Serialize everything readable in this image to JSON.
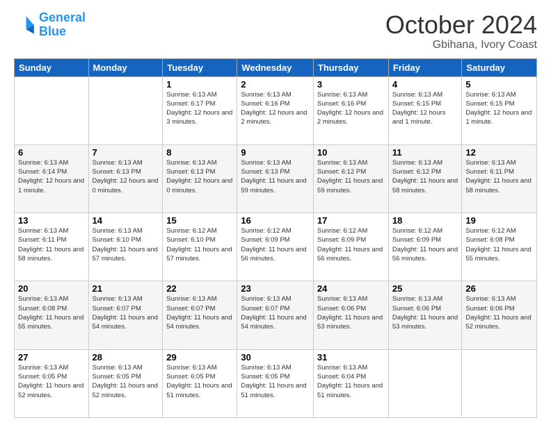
{
  "header": {
    "logo_line1": "General",
    "logo_line2": "Blue",
    "title": "October 2024",
    "subtitle": "Gbihana, Ivory Coast"
  },
  "days_of_week": [
    "Sunday",
    "Monday",
    "Tuesday",
    "Wednesday",
    "Thursday",
    "Friday",
    "Saturday"
  ],
  "weeks": [
    [
      {
        "day": "",
        "info": ""
      },
      {
        "day": "",
        "info": ""
      },
      {
        "day": "1",
        "info": "Sunrise: 6:13 AM\nSunset: 6:17 PM\nDaylight: 12 hours and 3 minutes."
      },
      {
        "day": "2",
        "info": "Sunrise: 6:13 AM\nSunset: 6:16 PM\nDaylight: 12 hours and 2 minutes."
      },
      {
        "day": "3",
        "info": "Sunrise: 6:13 AM\nSunset: 6:16 PM\nDaylight: 12 hours and 2 minutes."
      },
      {
        "day": "4",
        "info": "Sunrise: 6:13 AM\nSunset: 6:15 PM\nDaylight: 12 hours and 1 minute."
      },
      {
        "day": "5",
        "info": "Sunrise: 6:13 AM\nSunset: 6:15 PM\nDaylight: 12 hours and 1 minute."
      }
    ],
    [
      {
        "day": "6",
        "info": "Sunrise: 6:13 AM\nSunset: 6:14 PM\nDaylight: 12 hours and 1 minute."
      },
      {
        "day": "7",
        "info": "Sunrise: 6:13 AM\nSunset: 6:13 PM\nDaylight: 12 hours and 0 minutes."
      },
      {
        "day": "8",
        "info": "Sunrise: 6:13 AM\nSunset: 6:13 PM\nDaylight: 12 hours and 0 minutes."
      },
      {
        "day": "9",
        "info": "Sunrise: 6:13 AM\nSunset: 6:13 PM\nDaylight: 11 hours and 59 minutes."
      },
      {
        "day": "10",
        "info": "Sunrise: 6:13 AM\nSunset: 6:12 PM\nDaylight: 11 hours and 59 minutes."
      },
      {
        "day": "11",
        "info": "Sunrise: 6:13 AM\nSunset: 6:12 PM\nDaylight: 11 hours and 58 minutes."
      },
      {
        "day": "12",
        "info": "Sunrise: 6:13 AM\nSunset: 6:11 PM\nDaylight: 11 hours and 58 minutes."
      }
    ],
    [
      {
        "day": "13",
        "info": "Sunrise: 6:13 AM\nSunset: 6:11 PM\nDaylight: 11 hours and 58 minutes."
      },
      {
        "day": "14",
        "info": "Sunrise: 6:13 AM\nSunset: 6:10 PM\nDaylight: 11 hours and 57 minutes."
      },
      {
        "day": "15",
        "info": "Sunrise: 6:12 AM\nSunset: 6:10 PM\nDaylight: 11 hours and 57 minutes."
      },
      {
        "day": "16",
        "info": "Sunrise: 6:12 AM\nSunset: 6:09 PM\nDaylight: 11 hours and 56 minutes."
      },
      {
        "day": "17",
        "info": "Sunrise: 6:12 AM\nSunset: 6:09 PM\nDaylight: 11 hours and 56 minutes."
      },
      {
        "day": "18",
        "info": "Sunrise: 6:12 AM\nSunset: 6:09 PM\nDaylight: 11 hours and 56 minutes."
      },
      {
        "day": "19",
        "info": "Sunrise: 6:12 AM\nSunset: 6:08 PM\nDaylight: 11 hours and 55 minutes."
      }
    ],
    [
      {
        "day": "20",
        "info": "Sunrise: 6:13 AM\nSunset: 6:08 PM\nDaylight: 11 hours and 55 minutes."
      },
      {
        "day": "21",
        "info": "Sunrise: 6:13 AM\nSunset: 6:07 PM\nDaylight: 11 hours and 54 minutes."
      },
      {
        "day": "22",
        "info": "Sunrise: 6:13 AM\nSunset: 6:07 PM\nDaylight: 11 hours and 54 minutes."
      },
      {
        "day": "23",
        "info": "Sunrise: 6:13 AM\nSunset: 6:07 PM\nDaylight: 11 hours and 54 minutes."
      },
      {
        "day": "24",
        "info": "Sunrise: 6:13 AM\nSunset: 6:06 PM\nDaylight: 11 hours and 53 minutes."
      },
      {
        "day": "25",
        "info": "Sunrise: 6:13 AM\nSunset: 6:06 PM\nDaylight: 11 hours and 53 minutes."
      },
      {
        "day": "26",
        "info": "Sunrise: 6:13 AM\nSunset: 6:06 PM\nDaylight: 11 hours and 52 minutes."
      }
    ],
    [
      {
        "day": "27",
        "info": "Sunrise: 6:13 AM\nSunset: 6:05 PM\nDaylight: 11 hours and 52 minutes."
      },
      {
        "day": "28",
        "info": "Sunrise: 6:13 AM\nSunset: 6:05 PM\nDaylight: 11 hours and 52 minutes."
      },
      {
        "day": "29",
        "info": "Sunrise: 6:13 AM\nSunset: 6:05 PM\nDaylight: 11 hours and 51 minutes."
      },
      {
        "day": "30",
        "info": "Sunrise: 6:13 AM\nSunset: 6:05 PM\nDaylight: 11 hours and 51 minutes."
      },
      {
        "day": "31",
        "info": "Sunrise: 6:13 AM\nSunset: 6:04 PM\nDaylight: 11 hours and 51 minutes."
      },
      {
        "day": "",
        "info": ""
      },
      {
        "day": "",
        "info": ""
      }
    ]
  ]
}
